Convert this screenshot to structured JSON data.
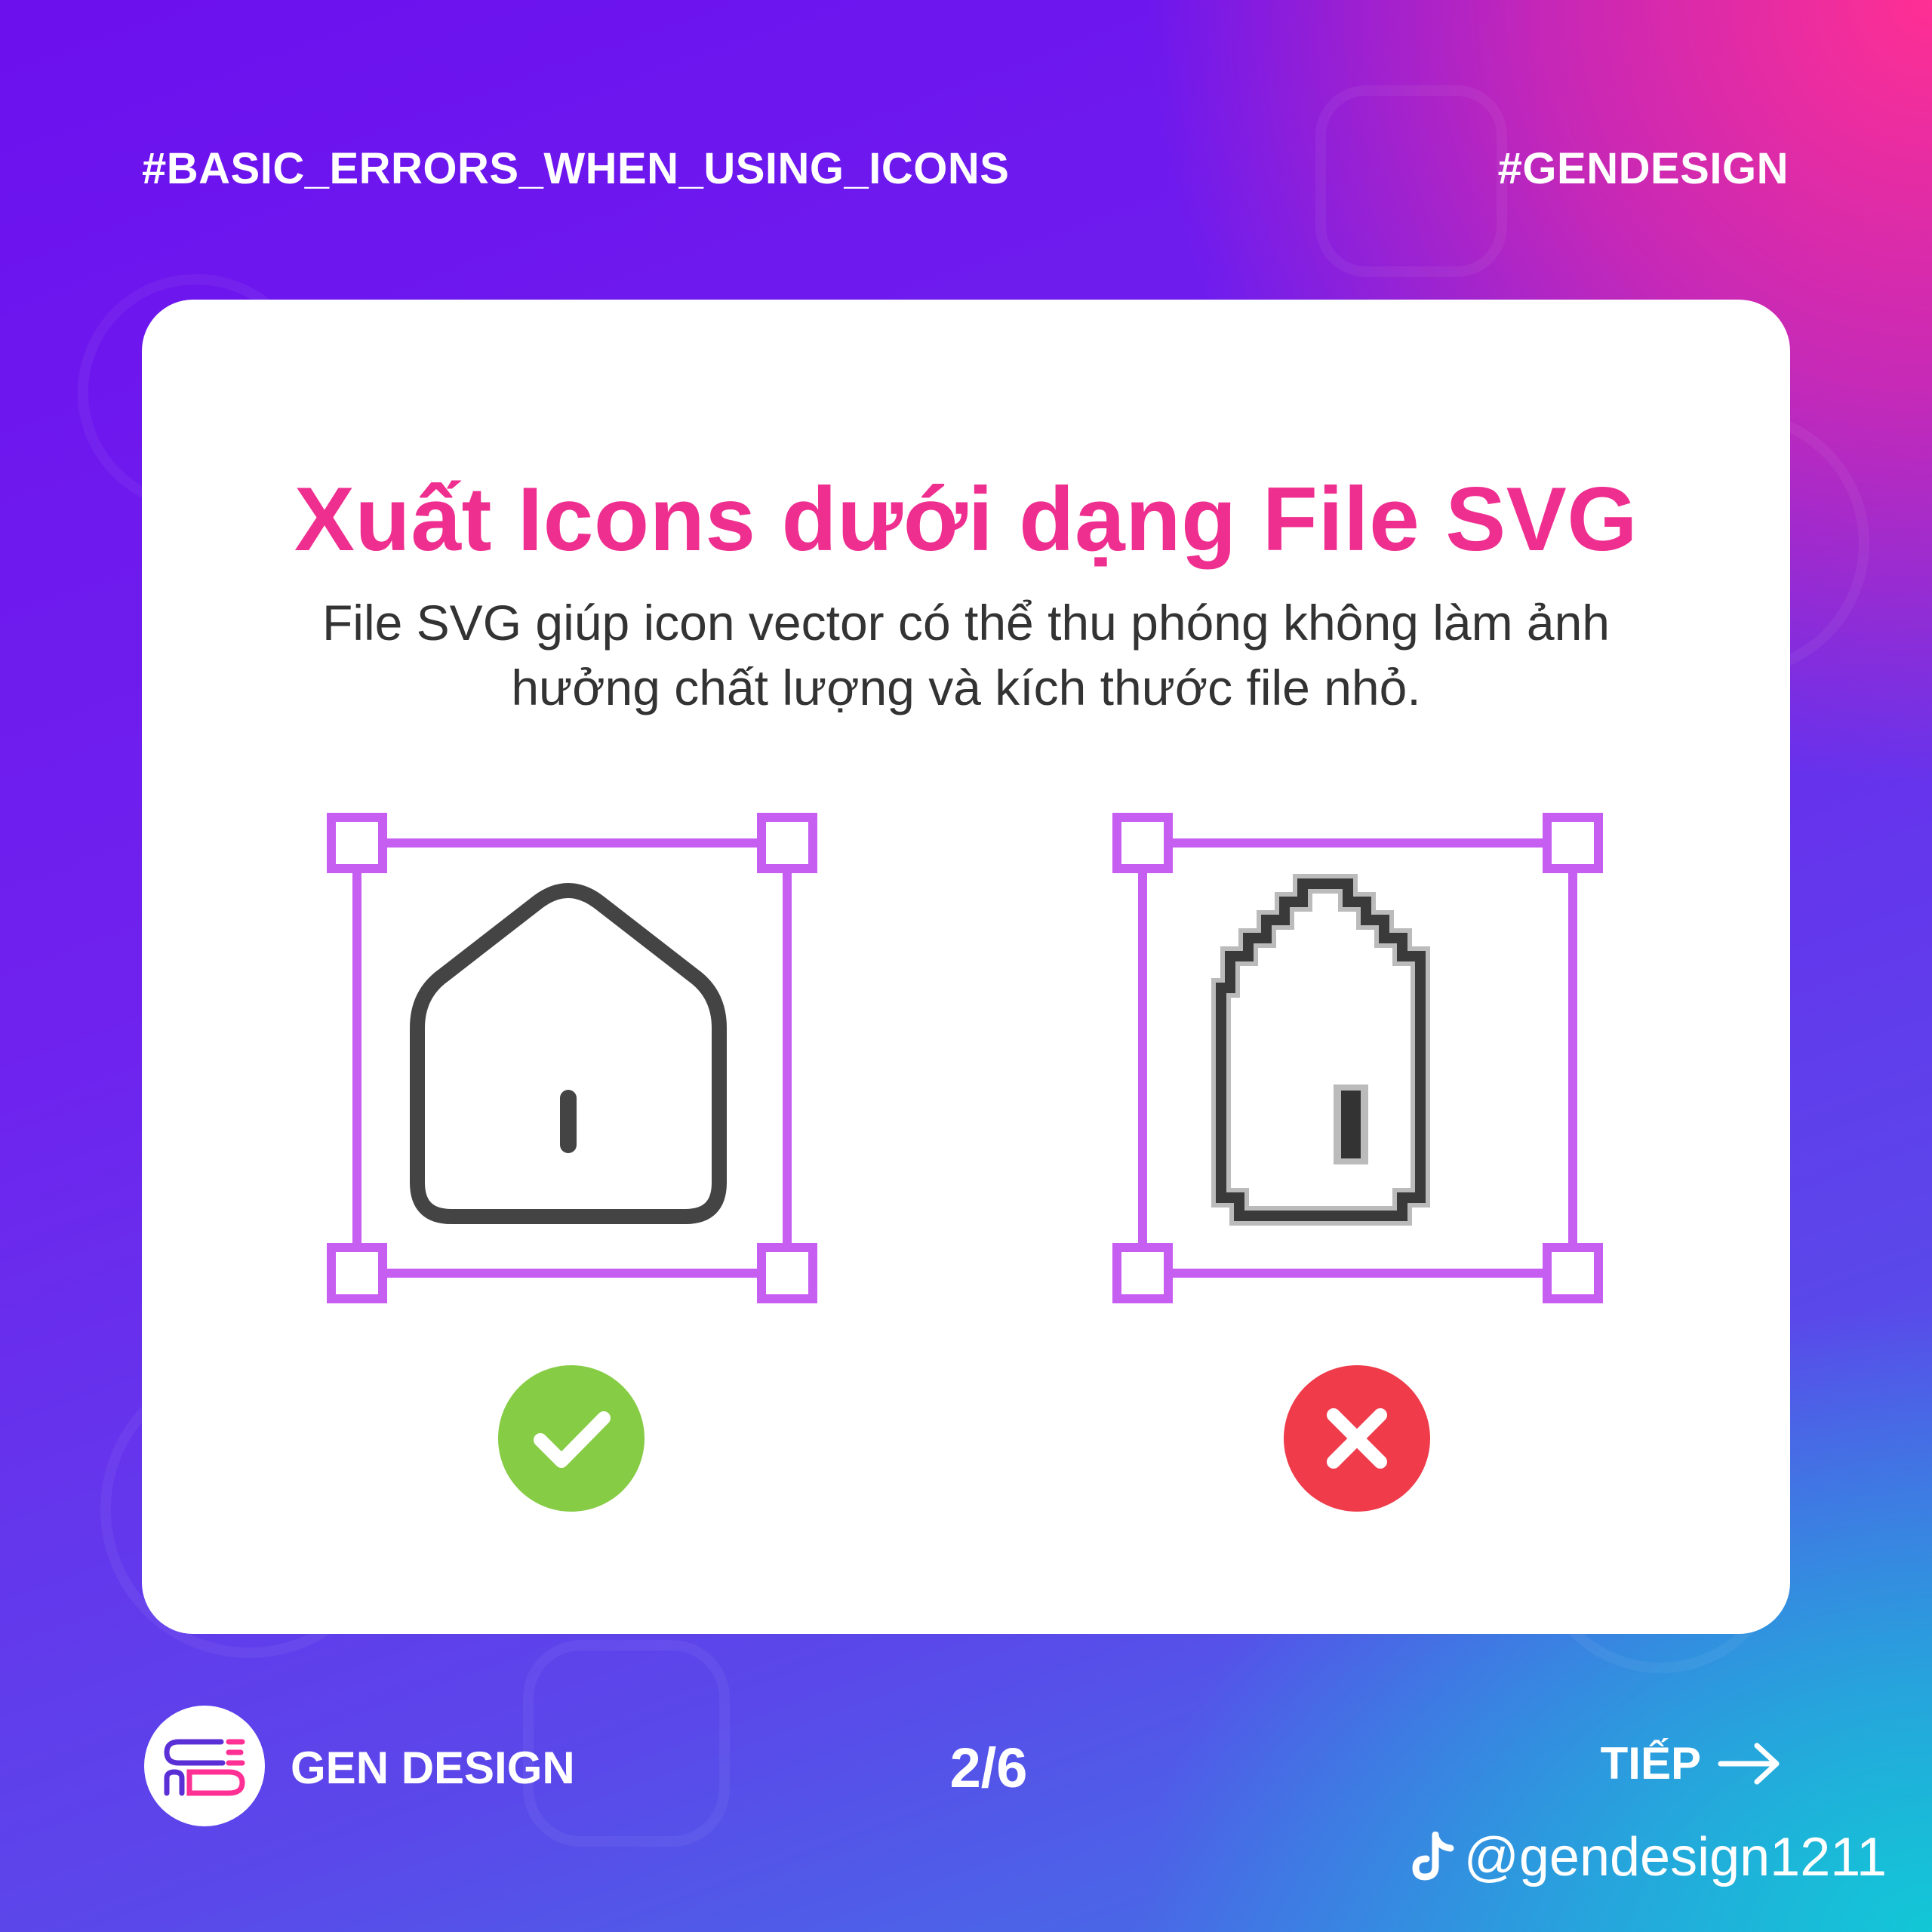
{
  "header": {
    "left_tag": "#BASIC_ERRORS_WHEN_USING_ICONS",
    "right_tag": "#GENDESIGN"
  },
  "card": {
    "title": "Xuất Icons dưới dạng File SVG",
    "description": "File SVG giúp icon vector có thể thu phóng không làm ảnh hưởng chất lượng và kích thước file nhỏ.",
    "examples": [
      {
        "icon": "home-icon-vector",
        "verdict": "check-icon",
        "verdict_color": "#86cc44"
      },
      {
        "icon": "home-icon-pixelated",
        "verdict": "cross-icon",
        "verdict_color": "#ef3b4a"
      }
    ],
    "frame_color": "#c65ef2",
    "title_color": "#ef2f8f"
  },
  "footer": {
    "brand": "GEN DESIGN",
    "page": "2/6",
    "next_label": "TIẾP",
    "handle": "@gendesign1211"
  }
}
